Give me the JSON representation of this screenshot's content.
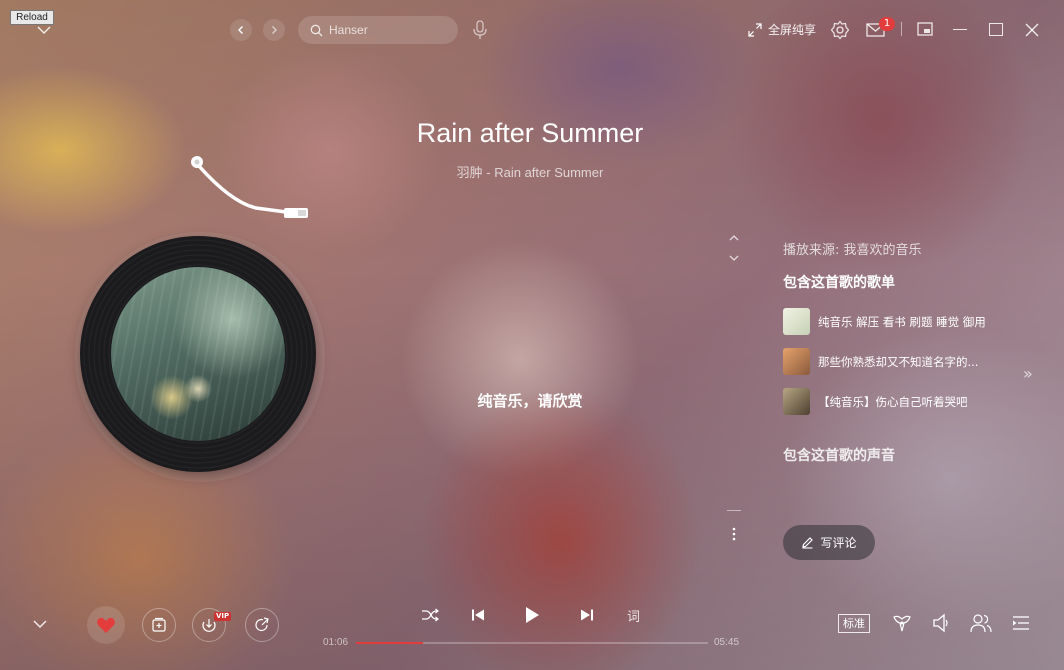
{
  "reload_label": "Reload",
  "search": {
    "placeholder": "Hanser"
  },
  "topbar": {
    "fullscreen_label": "全屏纯享",
    "notification_count": "1"
  },
  "song": {
    "title": "Rain after Summer",
    "subtitle": "羽肿 - Rain after Summer"
  },
  "lyrics": {
    "current": "纯音乐，请欣赏"
  },
  "panel": {
    "source": "播放来源: 我喜欢的音乐",
    "playlists_heading": "包含这首歌的歌单",
    "playlists": [
      {
        "name": "纯音乐 解压 看书 刷题 睡觉 御用",
        "thumb_color": "#dfe6cf"
      },
      {
        "name": "那些你熟悉却又不知道名字的...",
        "thumb_color": "#c98a5a"
      },
      {
        "name": "【纯音乐】伤心自己听着哭吧",
        "thumb_color": "#7c6b4e"
      }
    ],
    "voices_heading": "包含这首歌的声音",
    "comment_label": "写评论"
  },
  "player": {
    "time_current": "01:06",
    "time_total": "05:45",
    "progress": 0.19,
    "lyric_toggle": "词",
    "quality": "标准",
    "vip_badge": "VIP"
  },
  "colors": {
    "accent": "#e23c3c"
  }
}
